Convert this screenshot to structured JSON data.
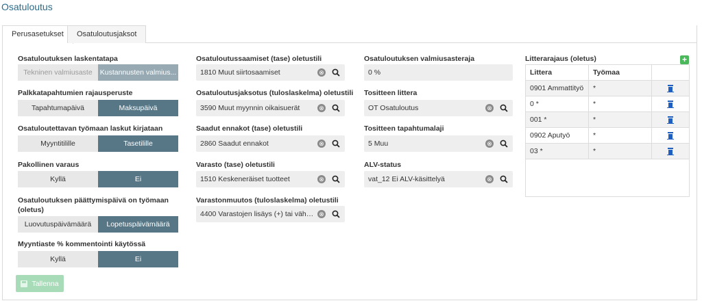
{
  "page_title": "Osatuloutus",
  "tabs": [
    {
      "label": "Perusasetukset",
      "active": true
    },
    {
      "label": "Osatuloutusjaksot",
      "active": false
    }
  ],
  "col1": {
    "laskentatapa": {
      "label": "Osatuloutuksen laskentatapa",
      "options": [
        "Tekninen valmiusaste",
        "Kustannusten valmius..."
      ],
      "selected": 1
    },
    "rajausperuste": {
      "label": "Palkkatapahtumien rajausperuste",
      "options": [
        "Tapahtumapäivä",
        "Maksupäivä"
      ],
      "selected": 1
    },
    "laskut": {
      "label": "Osatuloutettavan työmaan laskut kirjataan",
      "options": [
        "Myyntitilille",
        "Tasetilille"
      ],
      "selected": 1
    },
    "varaus": {
      "label": "Pakollinen varaus",
      "options": [
        "Kyllä",
        "Ei"
      ],
      "selected": 1
    },
    "paattymispaiva": {
      "label_line1": "Osatuloutuksen päättymispäivä on työmaan",
      "label_line2": "(oletus)",
      "options": [
        "Luovutuspäivämäärä",
        "Lopetuspäivämäärä"
      ],
      "selected": 1
    },
    "kommentointi": {
      "label": "Myyntiaste % kommentointi käytössä",
      "options": [
        "Kyllä",
        "Ei"
      ],
      "selected": 1
    },
    "save_label": "Tallenna"
  },
  "col2": [
    {
      "label": "Osatuloutussaamiset (tase) oletustili",
      "value": "1810 Muut siirtosaamiset"
    },
    {
      "label": "Osatuloutusjaksotus (tuloslaskelma) oletustili",
      "value": "3590 Muut myynnin oikaisuerät"
    },
    {
      "label": "Saadut ennakot (tase) oletustili",
      "value": "2860 Saadut ennakot"
    },
    {
      "label": "Varasto (tase) oletustili",
      "value": "1510 Keskeneräiset tuotteet"
    },
    {
      "label": "Varastonmuutos (tuloslaskelma) oletustili",
      "value": "4400 Varastojen lisäys (+) tai vähe ..."
    }
  ],
  "col3": {
    "valmiusasteraja": {
      "label": "Osatuloutuksen valmiusasteraja",
      "value": "0 %"
    },
    "tositteen_littera": {
      "label": "Tositteen littera",
      "value": "OT Osatuloutus"
    },
    "tapahtumalaji": {
      "label": "Tositteen tapahtumalaji",
      "value": "5 Muu"
    },
    "alv_status": {
      "label": "ALV-status",
      "value": "vat_12 Ei ALV-käsittelyä"
    }
  },
  "litterarajaus": {
    "title": "Litterarajaus (oletus)",
    "add_label": "+",
    "headers": [
      "Littera",
      "Työmaa"
    ],
    "rows": [
      [
        "0901 Ammattityö",
        "*"
      ],
      [
        "0 *",
        "*"
      ],
      [
        "001 *",
        "*"
      ],
      [
        "0902 Aputyö",
        "*"
      ],
      [
        "03 *",
        "*"
      ]
    ]
  },
  "icons": {
    "clear": "⊗",
    "search": "search-icon",
    "trash": "trash-icon",
    "save": "save-icon"
  },
  "colors": {
    "accent": "#577786",
    "title": "#2a6b8a",
    "save": "#a8dcb8",
    "add": "#4cb85c",
    "trash": "#1f5fbf"
  }
}
